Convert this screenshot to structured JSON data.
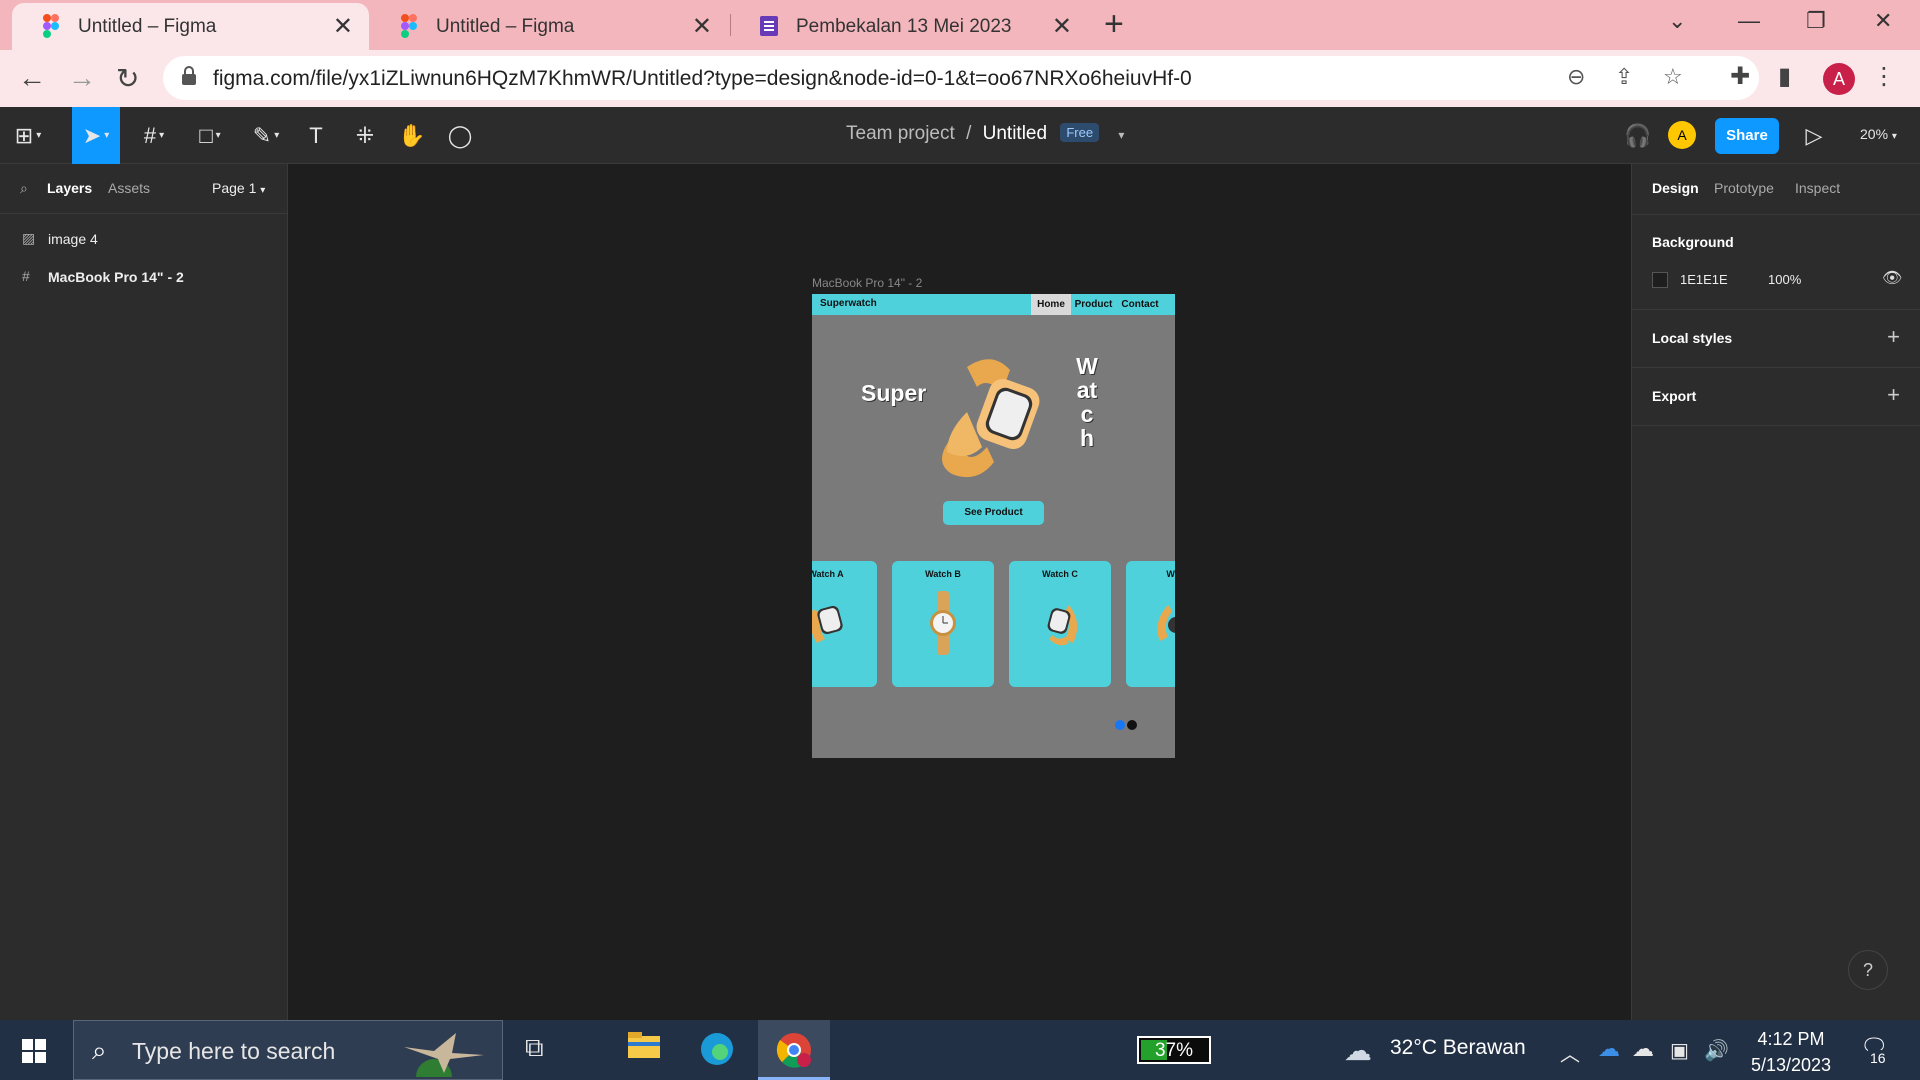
{
  "browser": {
    "tabs": [
      {
        "title": "Untitled – Figma",
        "active": true
      },
      {
        "title": "Untitled – Figma",
        "active": false
      },
      {
        "title": "Pembekalan 13 Mei 2023",
        "active": false
      }
    ],
    "url": "figma.com/file/yx1iZLiwnun6HQzM7KhmWR/Untitled?type=design&node-id=0-1&t=oo67NRXo6heiuvHf-0",
    "profile_initial": "A"
  },
  "figma": {
    "breadcrumb": {
      "team": "Team project",
      "separator": "/",
      "file": "Untitled",
      "plan_badge": "Free"
    },
    "collaborator_initial": "A",
    "share_label": "Share",
    "zoom": "20%",
    "left_panel": {
      "tabs": [
        "Layers",
        "Assets"
      ],
      "page": "Page 1",
      "layers": [
        {
          "name": "image 4",
          "icon": "image-icon"
        },
        {
          "name": "MacBook Pro 14\" - 2",
          "icon": "frame-icon"
        }
      ]
    },
    "right_panel": {
      "tabs": [
        "Design",
        "Prototype",
        "Inspect"
      ],
      "background_title": "Background",
      "background_hex": "1E1E1E",
      "background_opacity": "100%",
      "local_styles": "Local styles",
      "export": "Export"
    },
    "help": "?"
  },
  "design_frame": {
    "label": "MacBook Pro 14\" - 2",
    "brand": "Superwatch",
    "nav": [
      "Home",
      "Product",
      "Contact"
    ],
    "hero_left": "Super",
    "hero_right": "Watch",
    "cta": "See Product",
    "cards": [
      "Watch A",
      "Watch B",
      "Watch C",
      "Watc"
    ],
    "accent": "#4fd1dc",
    "background": "#7a7a7a"
  },
  "taskbar": {
    "search_placeholder": "Type here to search",
    "battery": "37%",
    "weather": "32°C  Berawan",
    "time": "4:12 PM",
    "date": "5/13/2023",
    "notifications": "16"
  }
}
